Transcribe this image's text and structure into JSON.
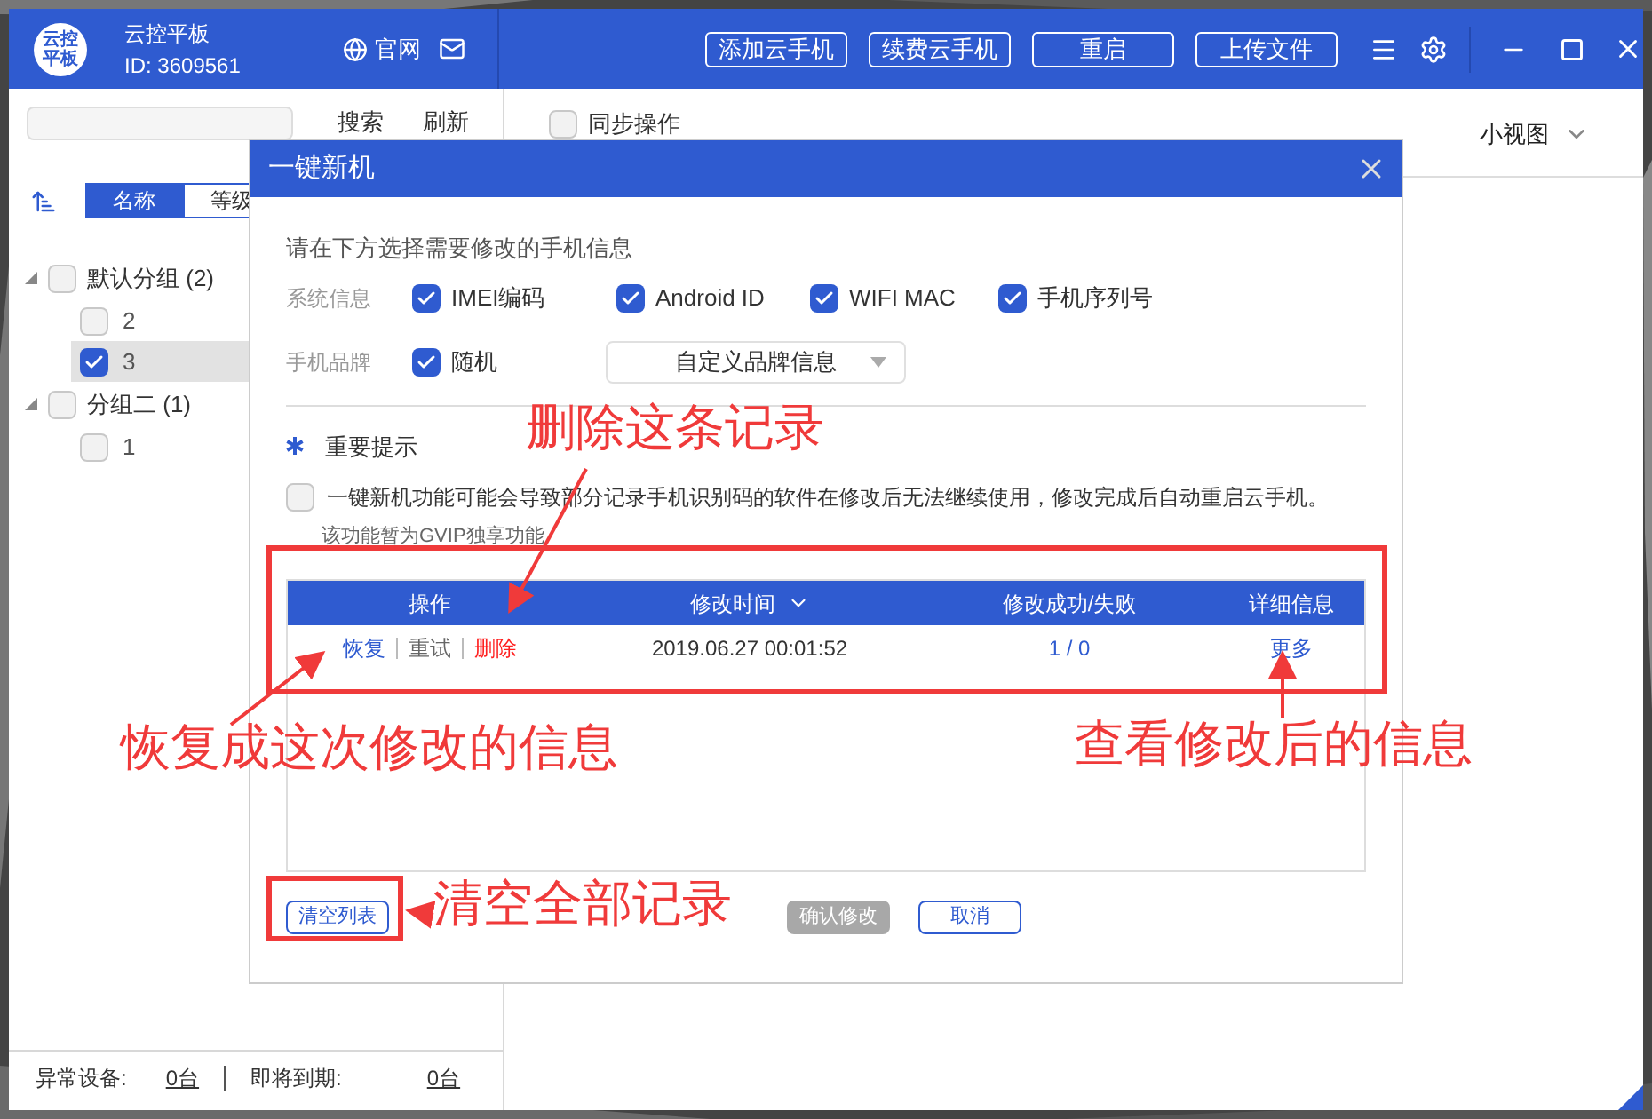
{
  "app": {
    "logo_lines": [
      "云控",
      "平板"
    ],
    "name": "云控平板",
    "id": "ID: 3609561",
    "website": "官网"
  },
  "toolbar_buttons": [
    "添加云手机",
    "续费云手机",
    "重启",
    "上传文件"
  ],
  "sidebar": {
    "search_button": "搜索",
    "refresh_button": "刷新",
    "sort_tabs": [
      {
        "label": "名称",
        "selected": true
      },
      {
        "label": "等级",
        "selected": false
      }
    ],
    "groups": [
      {
        "label": "默认分组",
        "count": "(2)",
        "checked": false,
        "expanded": true,
        "children": [
          {
            "label": "2",
            "checked": false,
            "selected": false
          },
          {
            "label": "3",
            "checked": true,
            "selected": true
          }
        ]
      },
      {
        "label": "分组二",
        "count": "(1)",
        "checked": false,
        "expanded": true,
        "children": [
          {
            "label": "1",
            "checked": false,
            "selected": false
          }
        ]
      }
    ]
  },
  "footer": {
    "abnormal_label": "异常设备:",
    "abnormal_value": "0台",
    "expiring_label": "即将到期:",
    "expiring_value": "0台"
  },
  "main": {
    "sync_label": "同步操作",
    "sync_checked": false,
    "view": "小视图"
  },
  "dialog": {
    "title": "一键新机",
    "prompt": "请在下方选择需要修改的手机信息",
    "system_label": "系统信息",
    "system_options": [
      {
        "label": "IMEI编码",
        "checked": true
      },
      {
        "label": "Android ID",
        "checked": true
      },
      {
        "label": "WIFI MAC",
        "checked": true
      },
      {
        "label": "手机序列号",
        "checked": true
      }
    ],
    "brand_label": "手机品牌",
    "brand_options": [
      {
        "label": "随机",
        "checked": true
      }
    ],
    "brand_select": "自定义品牌信息",
    "notice_title": "重要提示",
    "notice_checked": false,
    "notice_text": "一键新机功能可能会导致部分记录手机识别码的软件在修改后无法继续使用，修改完成后自动重启云手机。",
    "vip_note": "该功能暂为GVIP独享功能",
    "columns": [
      {
        "label": "操作",
        "sortable": false
      },
      {
        "label": "修改时间",
        "sortable": true
      },
      {
        "label": "修改成功/失败",
        "sortable": false
      },
      {
        "label": "详细信息",
        "sortable": false
      }
    ],
    "rows": [
      {
        "actions": [
          {
            "label": "恢复",
            "kind": "link"
          },
          {
            "label": "重试",
            "kind": "muted"
          },
          {
            "label": "删除",
            "kind": "danger"
          }
        ],
        "time": "2019.06.27 00:01:52",
        "result": "1 / 0",
        "detail": "更多"
      }
    ],
    "clear_button": "清空列表",
    "confirm_button": {
      "label": "确认修改",
      "disabled": true
    },
    "cancel_button": "取消"
  },
  "annotations": [
    {
      "text": "删除这条记录"
    },
    {
      "text": "恢复成这次修改的信息"
    },
    {
      "text": "查看修改后的信息"
    },
    {
      "text": "清空全部记录"
    }
  ]
}
